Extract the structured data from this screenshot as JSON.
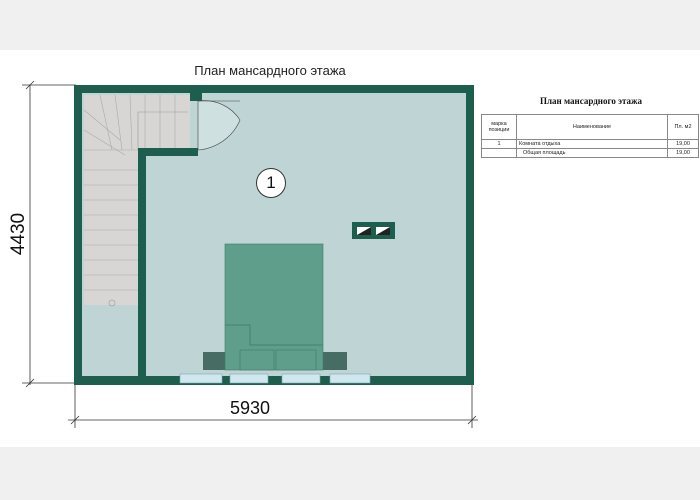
{
  "plan": {
    "title": "План мансардного этажа",
    "dim_height": "4430",
    "dim_width": "5930",
    "room_number": "1"
  },
  "table": {
    "title": "План мансардного этажа",
    "headers": [
      "марка позиции",
      "Наименование",
      "Пл. м2"
    ],
    "rows": [
      {
        "mark": "1",
        "name": "Комната отдыха",
        "area": "19,00"
      },
      {
        "mark": "",
        "name": "Общая площадь",
        "area": "19,00"
      }
    ]
  },
  "colors": {
    "wall": "#1e5e4f",
    "floor": "#bfd4d4",
    "stairs": "#d8d6d4",
    "bed": "#5f9e8b",
    "window": "#cfe8ef"
  }
}
